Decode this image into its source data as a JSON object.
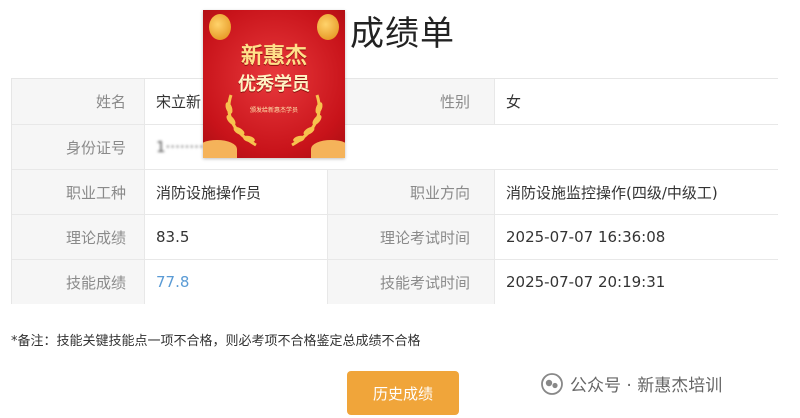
{
  "page": {
    "title": "成绩单"
  },
  "badge": {
    "line1": "新惠杰",
    "line2": "优秀学员",
    "line3": "颁发给新惠杰学员"
  },
  "rows": [
    {
      "label1": "姓名",
      "value1": "宋立新",
      "label2": "性别",
      "value2": "女"
    },
    {
      "label1": "身份证号",
      "value1": "1········"
    },
    {
      "label1": "职业工种",
      "value1": "消防设施操作员",
      "label2": "职业方向",
      "value2": "消防设施监控操作(四级/中级工)"
    },
    {
      "label1": "理论成绩",
      "value1": "83.5",
      "label2": "理论考试时间",
      "value2": "2025-07-07 16:36:08"
    },
    {
      "label1": "技能成绩",
      "value1": "77.8",
      "label2": "技能考试时间",
      "value2": "2025-07-07 20:19:31"
    }
  ],
  "note": "*备注：技能关键技能点一项不合格，则必考项不合格鉴定总成绩不合格",
  "button": {
    "label": "历史成绩"
  },
  "watermark": {
    "text": "公众号 · 新惠杰培训",
    "icon": "wechat-official-account-icon"
  },
  "colors": {
    "button": "#f0a53a",
    "link": "#5a9bd5",
    "badge": "#c8131a"
  }
}
